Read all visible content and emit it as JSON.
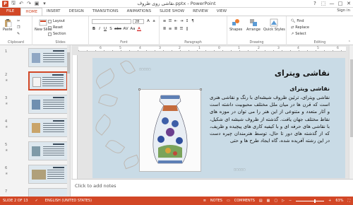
{
  "window": {
    "title": "نقاشی روی ظروف.pptx - PowerPoint",
    "sign_in": "Sign in",
    "controls": [
      "?",
      "—",
      "□",
      "✕"
    ]
  },
  "ribbon_tabs": [
    "FILE",
    "HOME",
    "INSERT",
    "DESIGN",
    "TRANSITIONS",
    "ANIMATIONS",
    "SLIDE SHOW",
    "REVIEW",
    "VIEW"
  ],
  "ribbon": {
    "clipboard": {
      "paste": "Paste",
      "label": "Clipboard"
    },
    "slides": {
      "new_slide": "New Slide",
      "layout": "Layout",
      "reset": "Reset",
      "section": "Section",
      "label": "Slides"
    },
    "font": {
      "size": "28",
      "label": "Font",
      "buttons": [
        "B",
        "I",
        "U",
        "S",
        "abc",
        "AV",
        "Aa",
        "A"
      ]
    },
    "paragraph": {
      "label": "Paragraph"
    },
    "drawing": {
      "shapes": "Shapes",
      "arrange": "Arrange",
      "quick_styles": "Quick Styles",
      "label": "Drawing"
    },
    "editing": {
      "find": "Find",
      "replace": "Replace",
      "select": "Select",
      "label": "Editing"
    }
  },
  "thumbnails": [
    {
      "num": "1"
    },
    {
      "num": "2"
    },
    {
      "num": "3"
    },
    {
      "num": "4"
    },
    {
      "num": "5"
    },
    {
      "num": "6"
    },
    {
      "num": "7"
    }
  ],
  "ruler_numbers": [
    "6",
    "5",
    "4",
    "3",
    "2",
    "1",
    "0",
    "1",
    "2",
    "3",
    "4",
    "5",
    "6"
  ],
  "slide": {
    "title": "نقاشی ویترای",
    "subtitle": "نقاشی ویترای",
    "body": "نقاشی ویترای، ترئین ظروف شیشه‌ای با رنگ و نقاشی هنری است که قرن ها در میان ملل مختلف محبوبیت داشته است و آثار متعدد و متنوعی از این هنر را می توان در موزه های نقاط مختلف جهان یافت. گذشته از ظروف شیشه ای شکیل، با نقاشی های حرفه ای و با کیفیه کاری های پیچیده و ظریف، که از گذشته های دور تا حال، توسط هنرمندان چیره دست در این رشته آفریده شده، گاه ایجاد طرح ها و حتی"
  },
  "notes_placeholder": "Click to add notes",
  "status": {
    "slide_info": "SLIDE 2 OF 13",
    "language": "ENGLISH (UNITED STATES)",
    "notes": "NOTES",
    "comments": "COMMENTS",
    "zoom": "63%"
  },
  "colors": {
    "accent": "#d24726",
    "slide_bg": "#c9dbe6"
  }
}
